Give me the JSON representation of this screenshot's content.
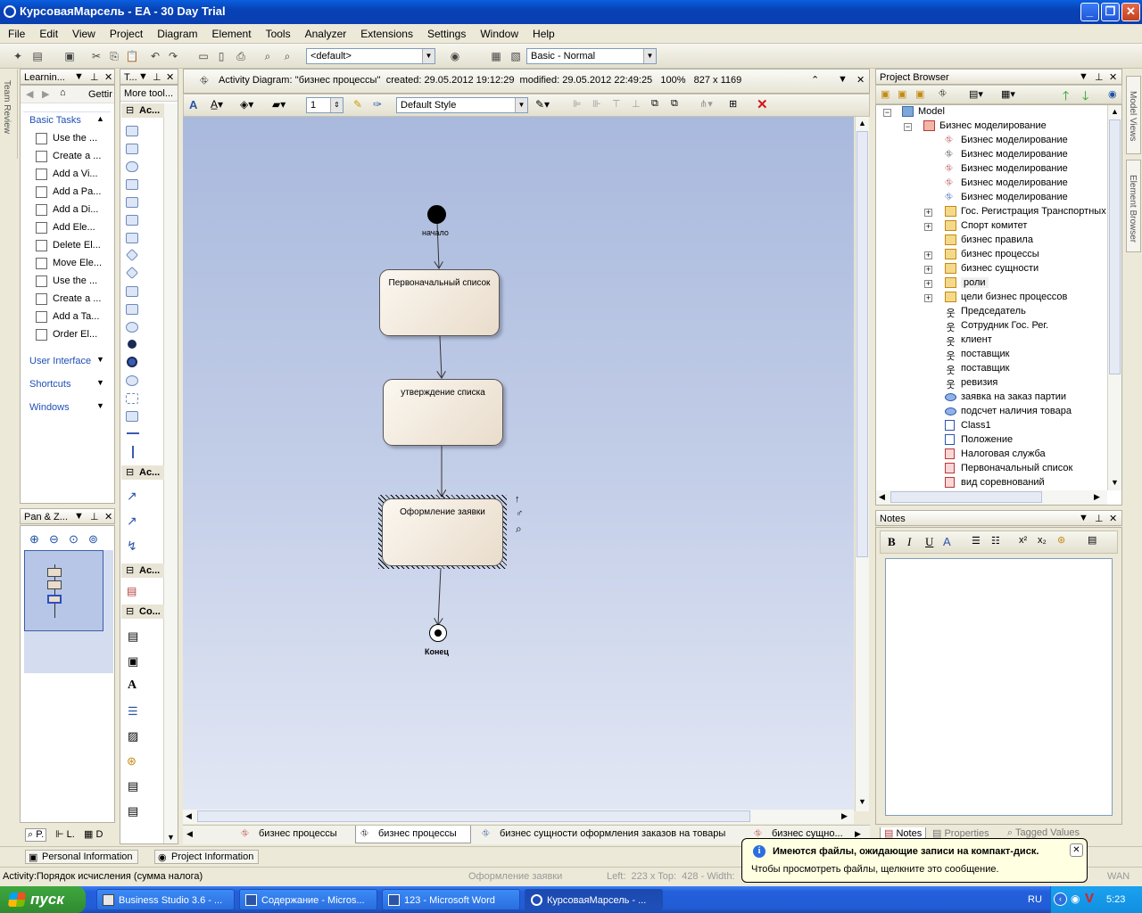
{
  "window": {
    "title": "КурсоваяМарсель - EA - 30 Day Trial",
    "btn_min": "_",
    "btn_max": "❐",
    "btn_close": "✕"
  },
  "menu": [
    "File",
    "Edit",
    "View",
    "Project",
    "Diagram",
    "Element",
    "Tools",
    "Analyzer",
    "Extensions",
    "Settings",
    "Window",
    "Help"
  ],
  "toolbar": {
    "perspective": "<default>",
    "workspace": "Basic - Normal"
  },
  "learning": {
    "title": "Learnin...",
    "getting": "Gettir",
    "basic_tasks": "Basic Tasks",
    "tasks": [
      "Use the ...",
      "Create a ...",
      "Add a Vi...",
      "Add a Pa...",
      "Add a Di...",
      "Add Ele...",
      "Delete El...",
      "Move Ele...",
      "Use the ...",
      "Create a ...",
      "Add a Ta...",
      "Order El..."
    ],
    "sections": [
      "User Interface",
      "Shortcuts",
      "Windows"
    ]
  },
  "toolbox": {
    "title": "T...",
    "more": "More tool...",
    "groups": [
      "Ac...",
      "Ac...",
      "Ac...",
      "Co..."
    ]
  },
  "pan": {
    "title": "Pan & Z..."
  },
  "left_tabs": [
    "P.",
    "L.",
    "D"
  ],
  "diagram": {
    "header": "Activity Diagram: ''бизнес процессы''  created: 29.05.2012 19:12:29  modified: 29.05.2012 22:49:25   100%   827 x 1169",
    "style": "Default Style",
    "line_width": "1",
    "start_label": "начало",
    "end_label": "Конец",
    "activities": [
      "Первоначальный список",
      "утверждение списка",
      "Оформление заявки"
    ]
  },
  "diagram_tabs": [
    "бизнес процессы",
    "бизнес процессы",
    "бизнес сущности оформления заказов на товары",
    "бизнес сущно..."
  ],
  "project_browser": {
    "title": "Project Browser",
    "tree": [
      {
        "label": "Model",
        "icon": "model-icon"
      },
      {
        "label": "Бизнес моделирование",
        "icon": "package-icon"
      },
      {
        "label": "Бизнес моделирование",
        "icon": "diagram-icon"
      },
      {
        "label": "Бизнес моделирование",
        "icon": "diagram-icon"
      },
      {
        "label": "Бизнес моделирование",
        "icon": "diagram-icon"
      },
      {
        "label": "Бизнес моделирование",
        "icon": "diagram-icon"
      },
      {
        "label": "Бизнес моделирование",
        "icon": "diagram-icon"
      },
      {
        "label": "Гос. Регистрация Транспортных",
        "icon": "folder-icon"
      },
      {
        "label": "Спорт комитет",
        "icon": "folder-icon"
      },
      {
        "label": "бизнес правила",
        "icon": "folder-icon"
      },
      {
        "label": "бизнес процессы",
        "icon": "folder-icon"
      },
      {
        "label": "бизнес сущности",
        "icon": "folder-icon"
      },
      {
        "label": "роли",
        "icon": "folder-icon"
      },
      {
        "label": "цели бизнес процессов",
        "icon": "folder-icon"
      },
      {
        "label": "Председатель",
        "icon": "actor-icon"
      },
      {
        "label": "Сотрудник Гос. Рег.",
        "icon": "actor-icon"
      },
      {
        "label": "клиент",
        "icon": "actor-icon"
      },
      {
        "label": "поставщик",
        "icon": "actor-icon"
      },
      {
        "label": "поставщик",
        "icon": "actor-icon"
      },
      {
        "label": "ревизия",
        "icon": "actor-icon"
      },
      {
        "label": "заявка на заказ партии",
        "icon": "usecase-icon"
      },
      {
        "label": "подсчет наличия товара",
        "icon": "usecase-icon"
      },
      {
        "label": "Class1",
        "icon": "class-icon"
      },
      {
        "label": "Положение",
        "icon": "class-icon"
      },
      {
        "label": "Налоговая служба",
        "icon": "class-icon"
      },
      {
        "label": "Первоначальный список",
        "icon": "class-icon"
      },
      {
        "label": "вид соревнований",
        "icon": "class-icon"
      }
    ]
  },
  "right_side_tabs": [
    "Model Views",
    "Element Browser"
  ],
  "notes": {
    "title": "Notes",
    "tabs": [
      "Notes",
      "Properties",
      "Tagged Values"
    ]
  },
  "bottom_tabs": [
    "Personal Information",
    "Project Information"
  ],
  "status": {
    "left": "Activity:Порядок исчисления (сумма налога)",
    "center": "Оформление заявки",
    "coords": "Left:  223 x Top:  428 - Width:",
    "wan": "WAN"
  },
  "balloon": {
    "title": "Имеются файлы, ожидающие записи на компакт-диск.",
    "text": "Чтобы просмотреть файлы, щелкните это сообщение."
  },
  "taskbar": {
    "start": "пуск",
    "tasks": [
      "Business Studio 3.6 - ...",
      "Содержание - Micros...",
      "123 - Microsoft Word",
      "КурсоваяМарсель - ..."
    ],
    "lang": "RU",
    "time": "5:23"
  }
}
